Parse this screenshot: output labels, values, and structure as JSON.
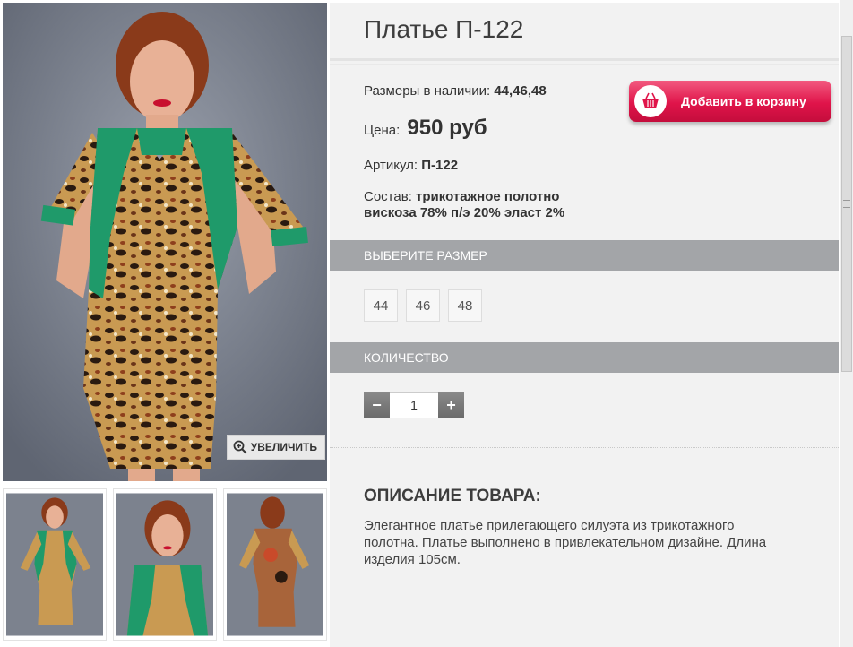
{
  "product": {
    "title": "Платье П-122",
    "sizes_label": "Размеры в наличии:",
    "sizes_value": "44,46,48",
    "price_label": "Цена:",
    "price_value": "950 руб",
    "sku_label": "Артикул:",
    "sku_value": "П-122",
    "composition_label": "Состав:",
    "composition_line1": "трикотажное полотно",
    "composition_line2": "вискоза 78% п/э 20% эласт 2%"
  },
  "cart_button": {
    "label": "Добавить в корзину",
    "icon": "basket-icon"
  },
  "gallery": {
    "zoom_label": "УВЕЛИЧИТЬ",
    "zoom_icon": "zoom-in-icon",
    "thumbnails": [
      "front-view",
      "close-up-view",
      "back-view"
    ]
  },
  "size_section": {
    "title": "ВЫБЕРИТЕ РАЗМЕР",
    "options": [
      "44",
      "46",
      "48"
    ]
  },
  "quantity_section": {
    "title": "КОЛИЧЕСТВО",
    "minus": "−",
    "plus": "+",
    "value": "1"
  },
  "description": {
    "title": "ОПИСАНИЕ ТОВАРА:",
    "text": "Элегантное платье прилегающего силуэта из трикотажного полотна. Платье выполнено в привлекательном дизайне. Длина изделия 105см."
  },
  "colors": {
    "accent": "#e0144a",
    "section_bar": "#a3a5a8",
    "dress_green": "#1f9a6a",
    "background": "#f2f2f2"
  }
}
